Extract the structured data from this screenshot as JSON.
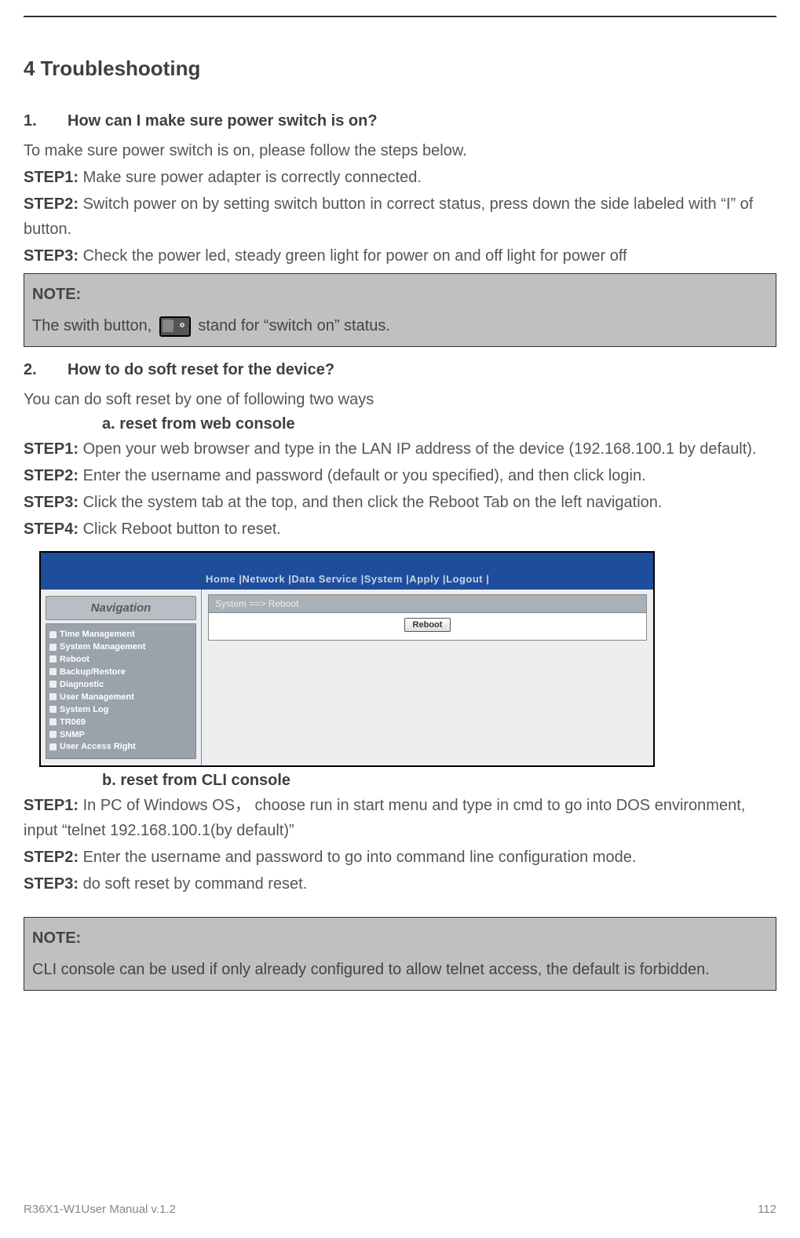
{
  "heading": "4  Troubleshooting",
  "q1": {
    "num": "1.",
    "title": "How can I make sure power switch is on?",
    "intro": "To make sure power switch is on, please follow the steps below.",
    "step1_label": "STEP1:",
    "step1": " Make sure power adapter is correctly connected.",
    "step2_label": "STEP2:",
    "step2": " Switch power on by setting switch button in correct status, press down the side labeled with “I” of button.",
    "step3_label": "STEP3:",
    "step3": " Check the power led, steady green light for power on and off light for power off"
  },
  "note1": {
    "label": "NOTE:",
    "before": "The swith button, ",
    "after": " stand for “switch on” status."
  },
  "q2": {
    "num": "2.",
    "title": "How to do soft reset for the device?",
    "intro": "You can do soft reset by one of following two ways",
    "sub_a": "a.  reset from web console",
    "a_step1_label": "STEP1:",
    "a_step1": " Open your web browser and type in the LAN IP address of the device (192.168.100.1 by default).",
    "a_step2_label": "STEP2:",
    "a_step2": " Enter the username and password (default or you specified), and then click login.",
    "a_step3_label": "STEP3:",
    "a_step3": " Click the system tab at the top, and then click the Reboot Tab on the left navigation.",
    "a_step4_label": "STEP4:",
    "a_step4": " Click Reboot button to reset.",
    "sub_b": "b.  reset from CLI console",
    "b_step1_label": "STEP1:",
    "b_step1": " In PC of Windows OS， choose run in start menu and type in cmd to go into DOS environment, input “telnet 192.168.100.1(by default)”",
    "b_step2_label": "STEP2:",
    "b_step2": " Enter the username and password to go into command line configuration mode.",
    "b_step3_label": "STEP3:",
    "b_step3": " do soft reset by command reset."
  },
  "screenshot": {
    "menu": "Home  |Network  |Data Service  |System  |Apply   |Logout  |",
    "nav_title": "Navigation",
    "nav_items": [
      "Time Management",
      "System Management",
      "Reboot",
      "Backup/Restore",
      "Diagnostic",
      "User Management",
      "System Log",
      "TR069",
      "SNMP",
      "User Access Right"
    ],
    "breadcrumb": "System ==> Reboot",
    "button": "Reboot"
  },
  "note2": {
    "label": "NOTE:",
    "text": "CLI console can be used if only already configured to allow telnet access, the default is forbidden."
  },
  "footer_left": "R36X1-W1User Manual v.1.2",
  "footer_right": "112"
}
